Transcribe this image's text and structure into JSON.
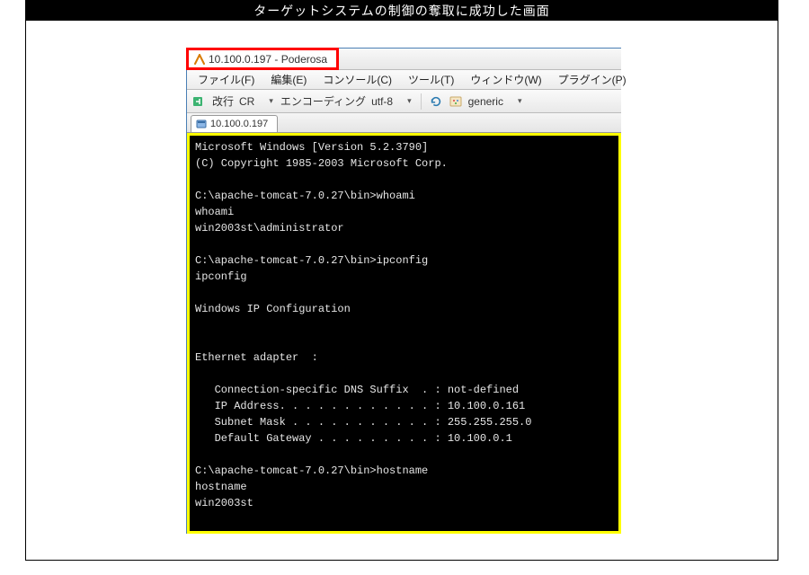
{
  "caption": "ターゲットシステムの制御の奪取に成功した画面",
  "window": {
    "title": "10.100.0.197 - Poderosa"
  },
  "menu": {
    "file": "ファイル(F)",
    "edit": "編集(E)",
    "console": "コンソール(C)",
    "tool": "ツール(T)",
    "window": "ウィンドウ(W)",
    "plugin": "プラグイン(P)"
  },
  "toolbar": {
    "newline_label": "改行",
    "newline_value": "CR",
    "encoding_label": "エンコーディング",
    "encoding_value": "utf-8",
    "generic_label": "generic"
  },
  "term_tab": {
    "label": "10.100.0.197"
  },
  "terminal": {
    "lines": [
      "Microsoft Windows [Version 5.2.3790]",
      "(C) Copyright 1985-2003 Microsoft Corp.",
      "",
      "C:\\apache-tomcat-7.0.27\\bin>whoami",
      "whoami",
      "win2003st\\administrator",
      "",
      "C:\\apache-tomcat-7.0.27\\bin>ipconfig",
      "ipconfig",
      "",
      "Windows IP Configuration",
      "",
      "",
      "Ethernet adapter  :",
      "",
      "   Connection-specific DNS Suffix  . : not-defined",
      "   IP Address. . . . . . . . . . . . : 10.100.0.161",
      "   Subnet Mask . . . . . . . . . . . : 255.255.255.0",
      "   Default Gateway . . . . . . . . . : 10.100.0.1",
      "",
      "C:\\apache-tomcat-7.0.27\\bin>hostname",
      "hostname",
      "win2003st"
    ]
  }
}
